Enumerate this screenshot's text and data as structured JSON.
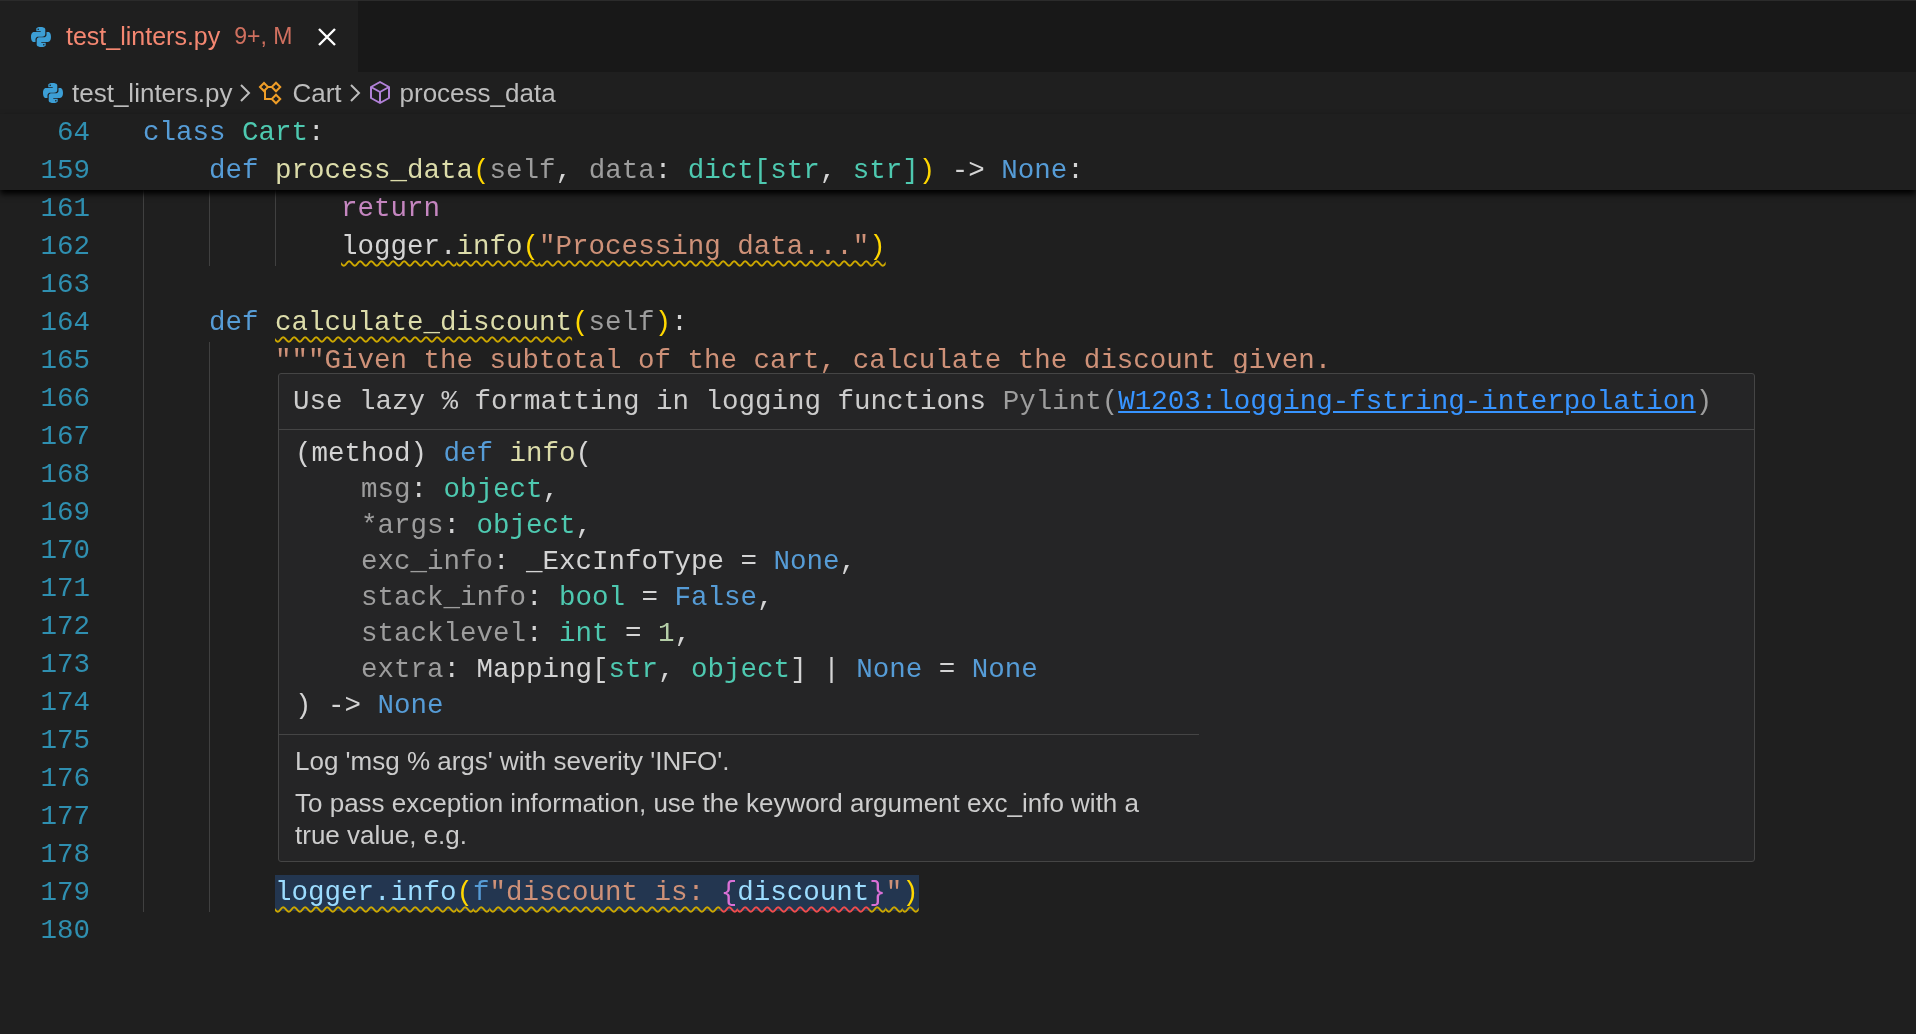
{
  "tab": {
    "label": "test_linters.py",
    "badge": "9+, M",
    "selected": true
  },
  "breadcrumb": [
    {
      "kind": "file",
      "label": "test_linters.py"
    },
    {
      "kind": "class",
      "label": "Cart"
    },
    {
      "kind": "method",
      "label": "process_data"
    }
  ],
  "sticky_lines": [
    {
      "number": "64",
      "tokens": [
        {
          "kind": "keyword",
          "text": "class "
        },
        {
          "kind": "type",
          "text": "Cart"
        },
        {
          "kind": "plain",
          "text": ":"
        }
      ]
    },
    {
      "number": "159",
      "tokens": [
        {
          "kind": "keyword",
          "text": "    def "
        },
        {
          "kind": "function",
          "text": "process_data"
        },
        {
          "kind": "bracket",
          "text": "("
        },
        {
          "kind": "param",
          "text": "self"
        },
        {
          "kind": "plain",
          "text": ", "
        },
        {
          "kind": "param",
          "text": "data"
        },
        {
          "kind": "plain",
          "text": ": "
        },
        {
          "kind": "type",
          "text": "dict[str"
        },
        {
          "kind": "plain",
          "text": ", "
        },
        {
          "kind": "type",
          "text": "str]"
        },
        {
          "kind": "bracket",
          "text": ")"
        },
        {
          "kind": "plain",
          "text": " -> "
        },
        {
          "kind": "keyword",
          "text": "None"
        },
        {
          "kind": "plain",
          "text": ":"
        }
      ]
    }
  ],
  "lines": [
    {
      "number": "161",
      "highlighted": false,
      "tokens": [
        {
          "kind": "control",
          "text": "            return"
        }
      ]
    },
    {
      "number": "162",
      "highlighted": false,
      "tokens": [
        {
          "kind": "plain",
          "text": "            logger.",
          "warning": true
        },
        {
          "kind": "function",
          "text": "info",
          "warning": true
        },
        {
          "kind": "bracket",
          "text": "(",
          "warning": true
        },
        {
          "kind": "string",
          "text": "\"Processing data...\"",
          "warning": true
        },
        {
          "kind": "bracket",
          "text": ")",
          "warning": true
        }
      ]
    },
    {
      "number": "163"
    },
    {
      "number": "164",
      "highlighted": false,
      "tokens": [
        {
          "kind": "keyword",
          "text": "    def "
        },
        {
          "kind": "function",
          "text": "calculate_discount",
          "warning": true
        },
        {
          "kind": "bracket",
          "text": "("
        },
        {
          "kind": "param",
          "text": "self"
        },
        {
          "kind": "bracket",
          "text": ")"
        },
        {
          "kind": "plain",
          "text": ":"
        }
      ]
    },
    {
      "number": "165",
      "highlighted": false,
      "tokens": [
        {
          "kind": "string",
          "text": "        \"\"\"Given the subtotal of the cart, calculate the discount given."
        }
      ]
    },
    {
      "number": "166"
    },
    {
      "number": "167"
    },
    {
      "number": "168"
    },
    {
      "number": "169"
    },
    {
      "number": "170"
    },
    {
      "number": "171"
    },
    {
      "number": "172"
    },
    {
      "number": "173"
    },
    {
      "number": "174"
    },
    {
      "number": "175"
    },
    {
      "number": "176"
    },
    {
      "number": "177"
    },
    {
      "number": "178"
    },
    {
      "number": "179",
      "highlighted": true,
      "tokens": [
        {
          "kind": "variable",
          "text": "        logger.info",
          "warning": true
        },
        {
          "kind": "bracket",
          "text": "(",
          "warning": true
        },
        {
          "kind": "keyword",
          "text": "f",
          "warning": true
        },
        {
          "kind": "string",
          "text": "\"discount is: ",
          "warning": true
        },
        {
          "kind": "bracket2",
          "text": "{",
          "error": true
        },
        {
          "kind": "variable",
          "text": "discount",
          "error": true
        },
        {
          "kind": "bracket2",
          "text": "}",
          "warning": true
        },
        {
          "kind": "string",
          "text": "\"",
          "warning": true
        },
        {
          "kind": "bracket",
          "text": ")",
          "warning": true
        }
      ]
    },
    {
      "number": "180"
    }
  ],
  "hover": {
    "diagnostic": {
      "message": "Use lazy % formatting in logging functions",
      "source": "Pylint(",
      "code": "W1203:logging-fstring-interpolation",
      "source_end": ")"
    },
    "signature": [
      {
        "tokens": [
          {
            "kind": "plain",
            "text": "(method) "
          },
          {
            "kind": "keyword",
            "text": "def "
          },
          {
            "kind": "function",
            "text": "info"
          },
          {
            "kind": "plain",
            "text": "("
          }
        ]
      },
      {
        "tokens": [
          {
            "kind": "param",
            "text": "    msg"
          },
          {
            "kind": "plain",
            "text": ": "
          },
          {
            "kind": "type",
            "text": "object"
          },
          {
            "kind": "plain",
            "text": ","
          }
        ]
      },
      {
        "tokens": [
          {
            "kind": "param",
            "text": "    *args"
          },
          {
            "kind": "plain",
            "text": ": "
          },
          {
            "kind": "type",
            "text": "object"
          },
          {
            "kind": "plain",
            "text": ","
          }
        ]
      },
      {
        "tokens": [
          {
            "kind": "param",
            "text": "    exc_info"
          },
          {
            "kind": "plain",
            "text": ": _ExcInfoType = "
          },
          {
            "kind": "keyword",
            "text": "None"
          },
          {
            "kind": "plain",
            "text": ","
          }
        ]
      },
      {
        "tokens": [
          {
            "kind": "param",
            "text": "    stack_info"
          },
          {
            "kind": "plain",
            "text": ": "
          },
          {
            "kind": "type",
            "text": "bool"
          },
          {
            "kind": "plain",
            "text": " = "
          },
          {
            "kind": "keyword",
            "text": "False"
          },
          {
            "kind": "plain",
            "text": ","
          }
        ]
      },
      {
        "tokens": [
          {
            "kind": "param",
            "text": "    stacklevel"
          },
          {
            "kind": "plain",
            "text": ": "
          },
          {
            "kind": "type",
            "text": "int"
          },
          {
            "kind": "plain",
            "text": " = "
          },
          {
            "kind": "number",
            "text": "1"
          },
          {
            "kind": "plain",
            "text": ","
          }
        ]
      },
      {
        "tokens": [
          {
            "kind": "param",
            "text": "    extra"
          },
          {
            "kind": "plain",
            "text": ": Mapping["
          },
          {
            "kind": "type",
            "text": "str"
          },
          {
            "kind": "plain",
            "text": ", "
          },
          {
            "kind": "type",
            "text": "object"
          },
          {
            "kind": "plain",
            "text": "] | "
          },
          {
            "kind": "keyword",
            "text": "None"
          },
          {
            "kind": "plain",
            "text": " = "
          },
          {
            "kind": "keyword",
            "text": "None"
          }
        ]
      },
      {
        "tokens": [
          {
            "kind": "plain",
            "text": ") -> "
          },
          {
            "kind": "keyword",
            "text": "None"
          }
        ]
      }
    ],
    "docs": [
      "Log 'msg % args' with severity 'INFO'.",
      "To pass exception information, use the keyword argument exc_info with a true value, e.g."
    ]
  }
}
